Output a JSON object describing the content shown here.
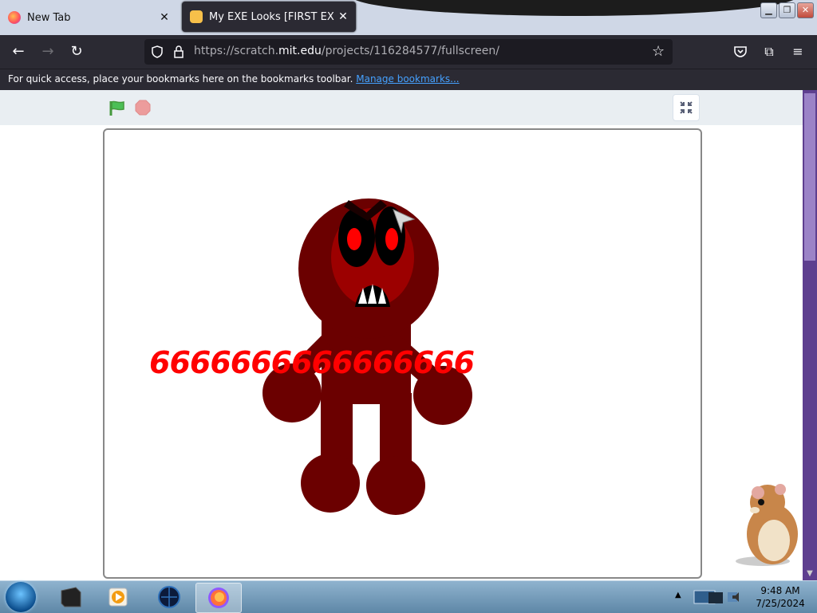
{
  "browser": {
    "tabs": [
      {
        "label": "New Tab",
        "active": false
      },
      {
        "label": "My EXE Looks [FIRST EXE LOOK",
        "active": true
      }
    ],
    "url": {
      "prefix": "https://scratch.",
      "host": "mit.edu",
      "path": "/projects/116284577/fullscreen/"
    },
    "bookmarks_bar": {
      "message": "For quick access, place your bookmarks here on the bookmarks toolbar.",
      "link": "Manage bookmarks..."
    }
  },
  "stage": {
    "text": "6666666666666666",
    "colors": {
      "body": "#6b0000",
      "face": "#9c0000",
      "eye": "#ff0000",
      "text": "#ff0000"
    }
  },
  "taskbar": {
    "clock_time": "9:48 AM",
    "clock_date": "7/25/2024"
  },
  "icons": [
    "firefox-icon",
    "close-icon",
    "back-icon",
    "forward-icon",
    "reload-icon",
    "shield-icon",
    "lock-icon",
    "star-icon",
    "pocket-icon",
    "extensions-icon",
    "menu-icon",
    "green-flag-icon",
    "stop-icon",
    "exit-fullscreen-icon",
    "start-orb-icon"
  ]
}
